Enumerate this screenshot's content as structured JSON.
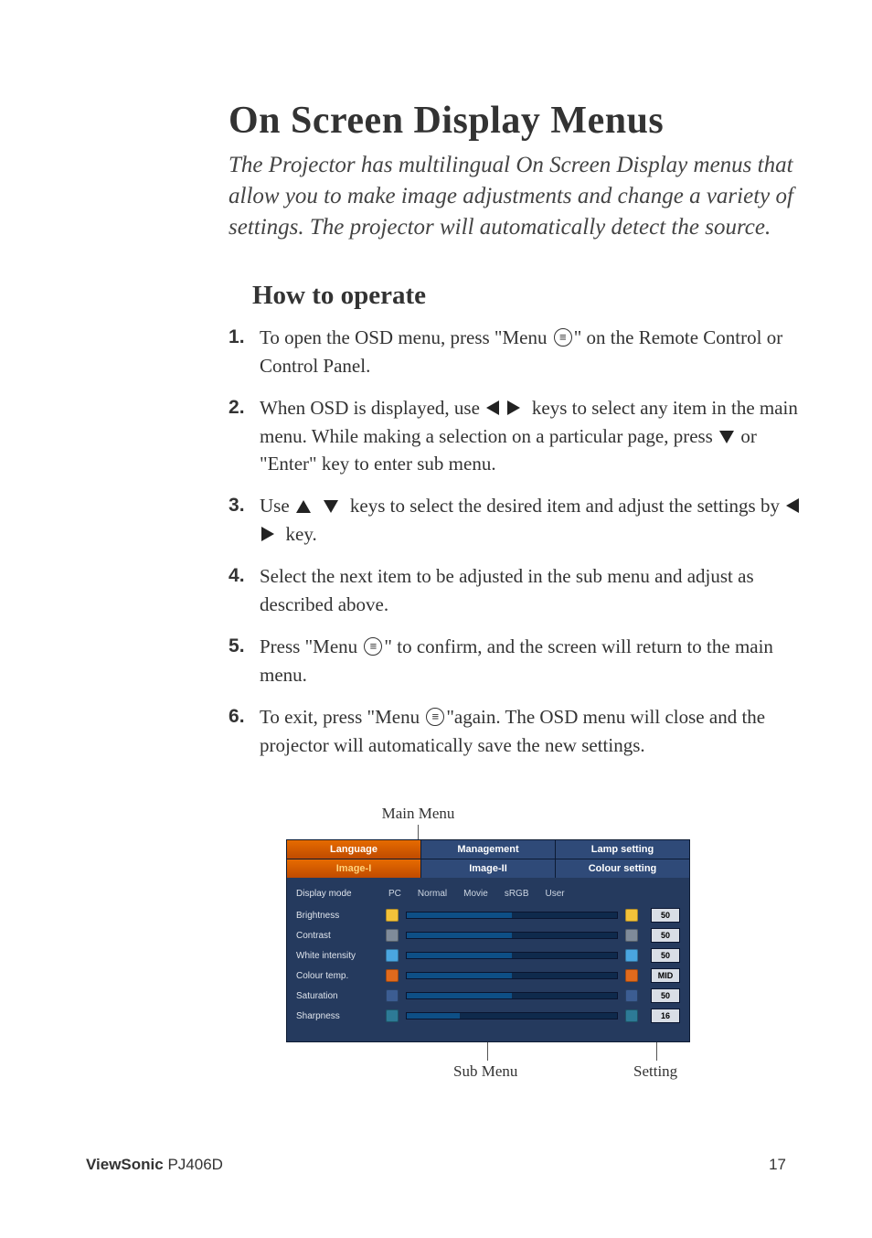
{
  "heading": "On Screen Display Menus",
  "intro": "The Projector has multilingual On Screen Display menus that allow you to make image adjustments and change a variety of settings. The projector will automatically detect the source.",
  "subheading": "How to operate",
  "steps": {
    "s1a": "To open the OSD menu, press \"Menu ",
    "s1b": "\" on the Remote Control or Control Panel.",
    "s2a": "When OSD is displayed, use ",
    "s2b": " keys to select any item in the main menu.  While making a selection on a particular page, press ",
    "s2c": " or \"Enter\" key to enter sub menu.",
    "s3a": "Use ",
    "s3b": " keys to select the desired item and adjust the settings by ",
    "s3c": " key.",
    "s4": "Select the next item to be adjusted in the sub menu and adjust as described above.",
    "s5a": "Press \"Menu ",
    "s5b": "\" to confirm, and the screen will return to the main menu.",
    "s6a": "To exit, press \"Menu ",
    "s6b": "\"again.  The OSD menu will close and the projector will automatically save the new settings."
  },
  "diagram": {
    "main_label": "Main Menu",
    "sub_label": "Sub Menu",
    "setting_label": "Setting"
  },
  "osd": {
    "tabs_row1": {
      "a": "Language",
      "b": "Management",
      "c": "Lamp setting"
    },
    "tabs_row2": {
      "a": "Image-I",
      "b": "Image-II",
      "c": "Colour setting"
    },
    "display_mode_label": "Display mode",
    "modes": {
      "pc": "PC",
      "normal": "Normal",
      "movie": "Movie",
      "srgb": "sRGB",
      "user": "User"
    },
    "items": [
      {
        "label": "Brightness",
        "value": "50",
        "icon": "ic-yellow"
      },
      {
        "label": "Contrast",
        "value": "50",
        "icon": "ic-gray"
      },
      {
        "label": "White intensity",
        "value": "50",
        "icon": "ic-blue"
      },
      {
        "label": "Colour temp.",
        "value": "MID",
        "icon": "ic-orange"
      },
      {
        "label": "Saturation",
        "value": "50",
        "icon": "ic-navy"
      },
      {
        "label": "Sharpness",
        "value": "16",
        "icon": "ic-teal"
      }
    ]
  },
  "footer": {
    "brand": "ViewSonic",
    "model": " PJ406D",
    "page": "17"
  }
}
